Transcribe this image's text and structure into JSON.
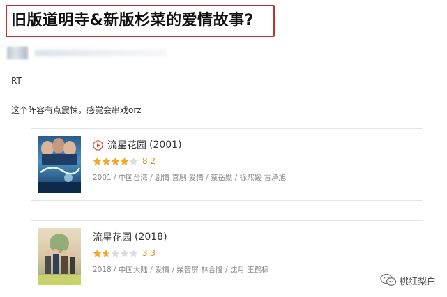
{
  "post": {
    "title": "旧版道明寺&新版杉菜的爱情故事?",
    "body_line1": "RT",
    "body_line2": "这个阵容有点震悚，感觉会串戏orz"
  },
  "cards": [
    {
      "name": "流星花园",
      "year": "(2001)",
      "score": "8.2",
      "rating": 4.1,
      "meta": "2001 / 中国台湾 / 剧情 喜剧 爱情 / 蔡岳勋 / 徐熙媛 言承旭",
      "play_icon": "play-circle-icon"
    },
    {
      "name": "流星花园",
      "year": "(2018)",
      "score": "3.3",
      "rating": 1.65,
      "meta": "2018 / 中国大陆 / 爱情 / 柴智屏 林合隆 / 沈月 王鹤棣"
    }
  ],
  "watermark": {
    "text": "桃红梨白",
    "icon": "wechat-icon"
  },
  "colors": {
    "title_border": "#c0302c",
    "star_filled": "#f5a623",
    "star_empty": "#dcdcdc",
    "score": "#e09015"
  }
}
